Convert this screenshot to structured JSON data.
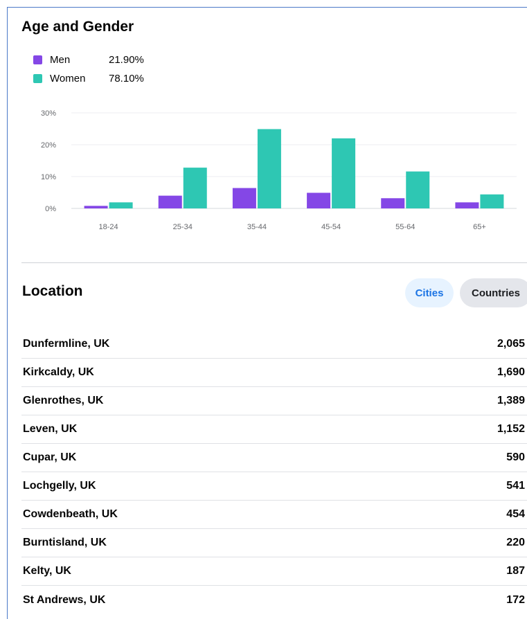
{
  "age_gender": {
    "title": "Age and Gender",
    "legend": [
      {
        "label": "Men",
        "value": "21.90%",
        "color": "#8447e6"
      },
      {
        "label": "Women",
        "value": "78.10%",
        "color": "#2ec7b3"
      }
    ]
  },
  "chart_data": {
    "type": "bar",
    "categories": [
      "18-24",
      "25-34",
      "35-44",
      "45-54",
      "55-64",
      "65+"
    ],
    "series": [
      {
        "name": "Men",
        "color": "#8447e6",
        "values": [
          0.8,
          4.0,
          6.4,
          4.9,
          3.2,
          1.9
        ]
      },
      {
        "name": "Women",
        "color": "#2ec7b3",
        "values": [
          1.9,
          12.8,
          24.9,
          22.0,
          11.6,
          4.4
        ]
      }
    ],
    "ylim": [
      0,
      30
    ],
    "yticks": [
      "0%",
      "10%",
      "20%",
      "30%"
    ],
    "grid": true
  },
  "location": {
    "title": "Location",
    "tabs": {
      "cities": "Cities",
      "countries": "Countries"
    },
    "rows": [
      {
        "name": "Dunfermline, UK",
        "value": "2,065"
      },
      {
        "name": "Kirkcaldy, UK",
        "value": "1,690"
      },
      {
        "name": "Glenrothes, UK",
        "value": "1,389"
      },
      {
        "name": "Leven, UK",
        "value": "1,152"
      },
      {
        "name": "Cupar, UK",
        "value": "590"
      },
      {
        "name": "Lochgelly, UK",
        "value": "541"
      },
      {
        "name": "Cowdenbeath, UK",
        "value": "454"
      },
      {
        "name": "Burntisland, UK",
        "value": "220"
      },
      {
        "name": "Kelty, UK",
        "value": "187"
      },
      {
        "name": "St Andrews, UK",
        "value": "172"
      }
    ]
  }
}
